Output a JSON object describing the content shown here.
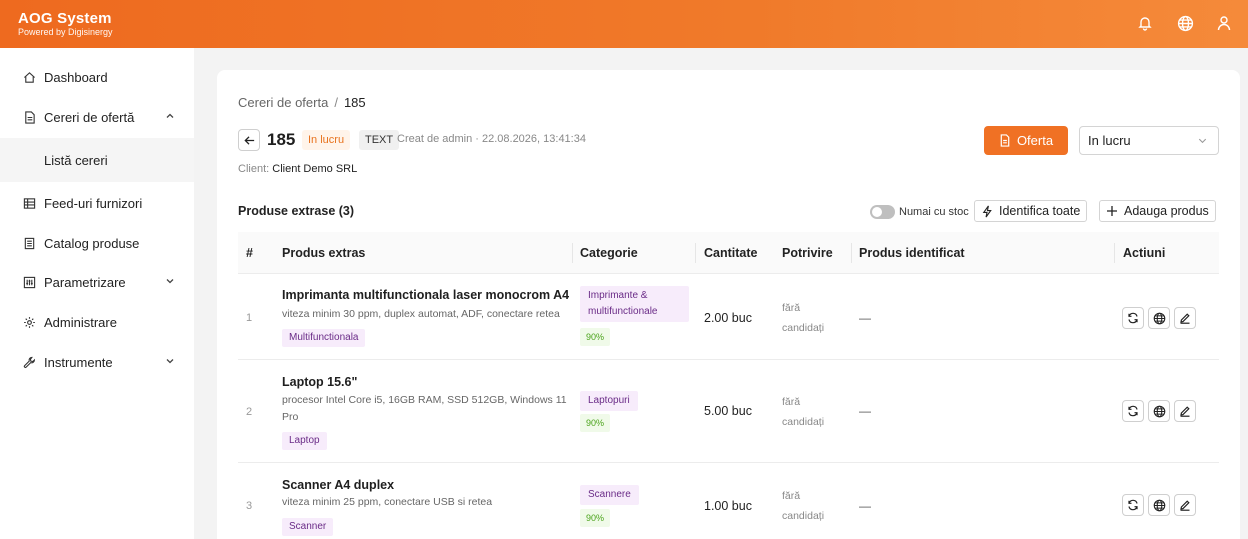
{
  "app": {
    "title": "AOG System",
    "subtitle": "Powered by Digisinergy"
  },
  "header_icons": [
    "bell-icon",
    "globe-icon",
    "user-icon"
  ],
  "sidebar": {
    "items": [
      {
        "label": "Dashboard",
        "icon": "home-icon"
      },
      {
        "label": "Cereri de ofertă",
        "icon": "document-icon",
        "expanded": true
      },
      {
        "label": "Listă cereri",
        "sub": true
      },
      {
        "label": "Feed-uri furnizori",
        "icon": "feed-icon"
      },
      {
        "label": "Catalog produse",
        "icon": "catalog-icon"
      },
      {
        "label": "Parametrizare",
        "icon": "sliders-icon"
      },
      {
        "label": "Administrare",
        "icon": "gear-icon"
      },
      {
        "label": "Instrumente",
        "icon": "wrench-icon"
      }
    ]
  },
  "breadcrumb": {
    "parent": "Cereri de oferta",
    "separator": "/",
    "current": "185"
  },
  "request": {
    "id": "185",
    "status_badge": "In lucru",
    "type_badge": "TEXT",
    "created": "Creat de admin · 22.08.2026, 13:41:34",
    "client_label": "Client:",
    "client_value": "Client Demo SRL"
  },
  "actions": {
    "oferta_label": "Oferta",
    "status_value": "In lucru"
  },
  "products": {
    "title": "Produse extrase (3)",
    "toggle_label": "Numai cu stoc",
    "identify_all_label": "Identifica toate",
    "add_product_label": "Adauga produs",
    "columns": [
      "#",
      "Produs extras",
      "Categorie",
      "Cantitate",
      "Potrivire",
      "Produs identificat",
      "Actiuni"
    ],
    "rows": [
      {
        "num": "1",
        "name": "Imprimanta multifunctionala laser monocrom A4",
        "desc": "viteza minim 30 ppm, duplex automat, ADF, conectare retea",
        "tag": "Multifunctionala",
        "category": "Imprimante & multifunctionale",
        "confidence": "90%",
        "quantity": "2.00 buc",
        "match": "fără candidați",
        "identified": "—"
      },
      {
        "num": "2",
        "name": "Laptop 15.6\"",
        "desc": "procesor Intel Core i5, 16GB RAM, SSD 512GB, Windows 11 Pro",
        "tag": "Laptop",
        "category": "Laptopuri",
        "confidence": "90%",
        "quantity": "5.00 buc",
        "match": "fără candidați",
        "identified": "—"
      },
      {
        "num": "3",
        "name": "Scanner A4 duplex",
        "desc": "viteza minim 25 ppm, conectare USB si retea",
        "tag": "Scanner",
        "category": "Scannere",
        "confidence": "90%",
        "quantity": "1.00 buc",
        "match": "fără candidați",
        "identified": "—"
      }
    ]
  },
  "colors": {
    "brand": "#f07124",
    "tag_bg": "#f7ecfb",
    "pct_fg": "#4aa31a"
  }
}
